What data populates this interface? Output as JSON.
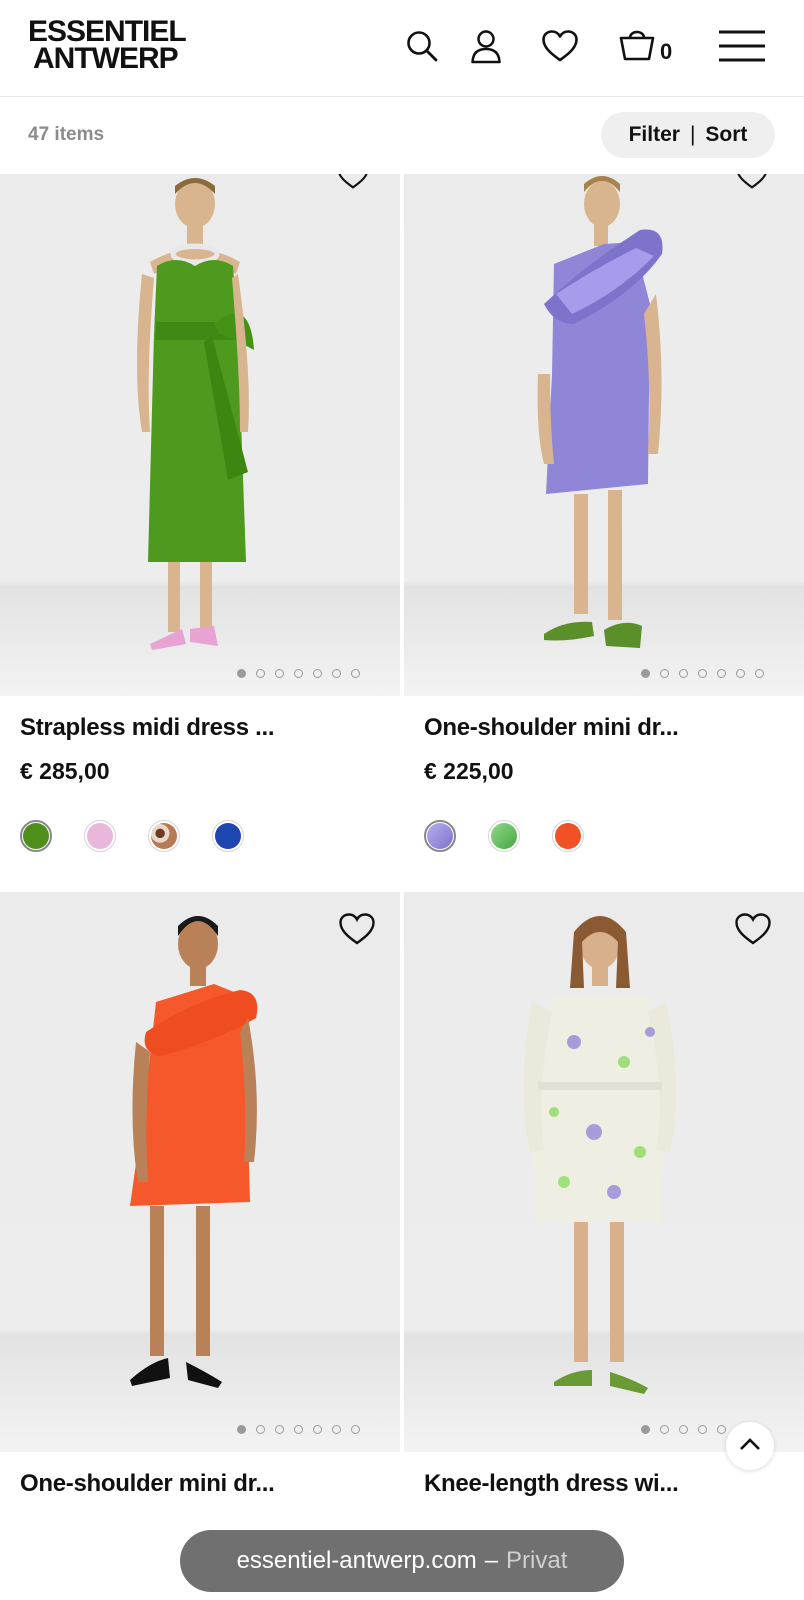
{
  "header": {
    "logo_line1": "ESSENTIEL",
    "logo_line2": "ANTWERP",
    "cart_count": "0",
    "icons": [
      "search-icon",
      "account-icon",
      "wishlist-heart-icon",
      "cart-basket-icon",
      "menu-hamburger-icon"
    ]
  },
  "toolbar": {
    "item_count": "47 items",
    "filter_label": "Filter",
    "separator": "|",
    "sort_label": "Sort"
  },
  "products": [
    {
      "name": "Strapless midi dress ...",
      "price": "€ 285,00",
      "dress_color": "#4d9a1e",
      "active_dot": 0,
      "dots": 7,
      "swatches": [
        {
          "color": "#4e8f1c",
          "selected": true
        },
        {
          "color": "#e9b7dc",
          "selected": false
        },
        {
          "color": "#b87a55",
          "selected": false
        },
        {
          "color": "#1f46b0",
          "selected": false
        }
      ]
    },
    {
      "name": "One-shoulder mini dr...",
      "price": "€ 225,00",
      "dress_color": "#8f86d8",
      "active_dot": 0,
      "dots": 7,
      "swatches": [
        {
          "color": "#9b90d6",
          "selected": true
        },
        {
          "color": "#6ec46a",
          "selected": false
        },
        {
          "color": "#f05125",
          "selected": false
        }
      ]
    },
    {
      "name": "One-shoulder mini dr...",
      "price": "",
      "dress_color": "#f4582b",
      "active_dot": 0,
      "dots": 7,
      "swatches": []
    },
    {
      "name": "Knee-length dress wi...",
      "price": "",
      "dress_color": "#efeee3",
      "active_dot": 0,
      "dots": 7,
      "swatches": []
    }
  ],
  "browser": {
    "url": "essentiel-antwerp.com",
    "dash": "–",
    "mode": "Privat"
  }
}
